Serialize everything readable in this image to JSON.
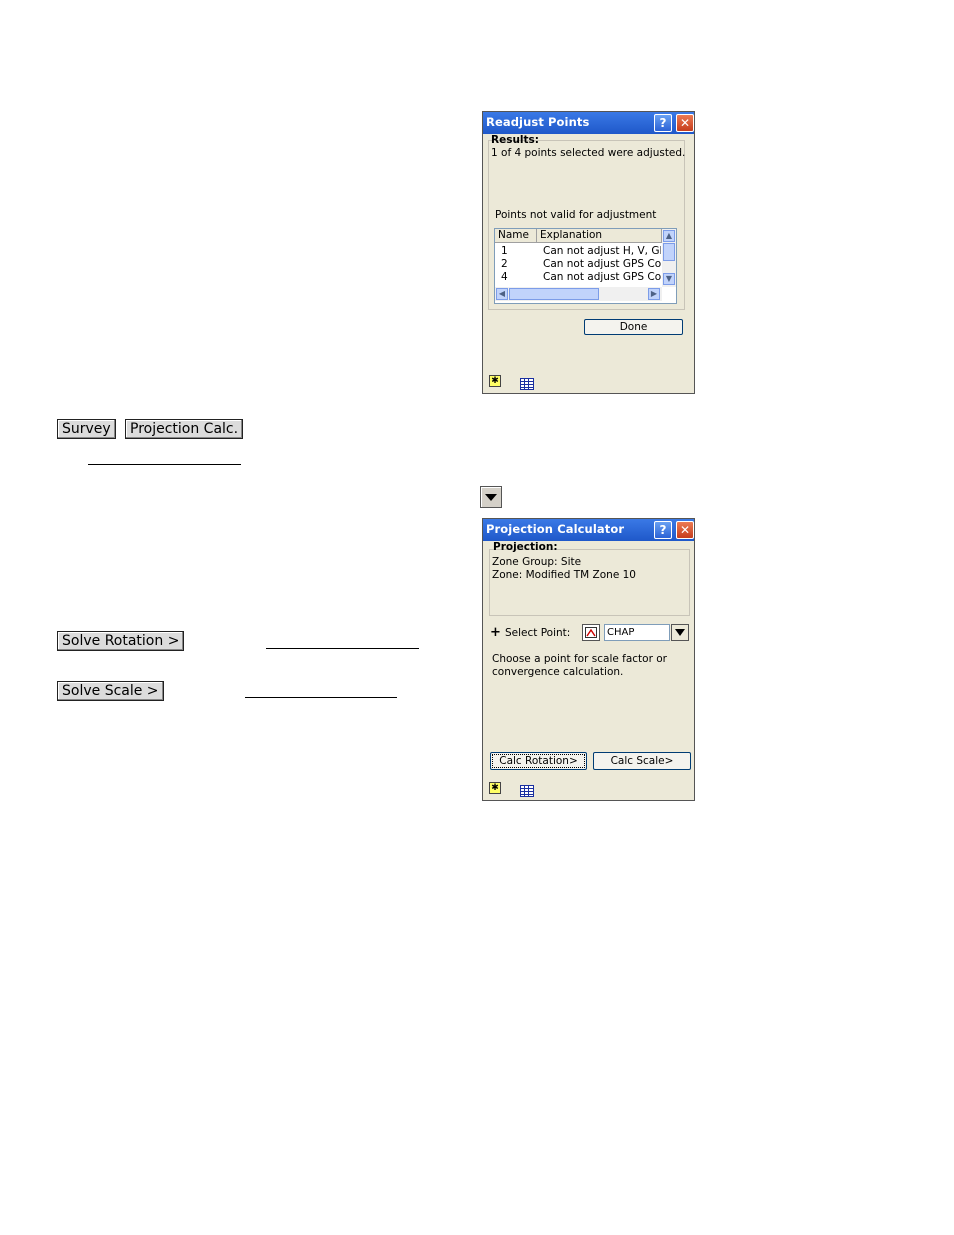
{
  "doc": {
    "survey_btn": "Survey",
    "projection_calc_btn": "Projection Calc.",
    "solve_rotation_btn": "Solve Rotation >",
    "solve_scale_btn": "Solve Scale >"
  },
  "readjust": {
    "title": "Readjust Points",
    "results_label": "Results:",
    "results_text": "1 of 4 points selected were adjusted.",
    "invalid_label": "Points not valid for adjustment",
    "columns": [
      "Name",
      "Explanation"
    ],
    "rows": [
      {
        "name": "1",
        "explanation": "Can not adjust H, V, GPS"
      },
      {
        "name": "2",
        "explanation": "Can not adjust GPS Con"
      },
      {
        "name": "4",
        "explanation": "Can not adjust GPS Con"
      }
    ],
    "done_btn": "Done"
  },
  "projcalc": {
    "title": "Projection Calculator",
    "projection_label": "Projection:",
    "zone_group": "Zone Group: Site",
    "zone": "Zone: Modified TM Zone 10",
    "select_point_label": "Select Point:",
    "select_point_value": "CHAP",
    "hint_line1": "Choose a point for scale factor or",
    "hint_line2": "convergence calculation.",
    "calc_rotation_btn": "Calc Rotation>",
    "calc_scale_btn": "Calc Scale>"
  },
  "colors": {
    "titlebar": "#1f58c9",
    "window_bg": "#ece9d8"
  },
  "icons": [
    "help-icon",
    "close-icon",
    "star-icon",
    "grid-icon",
    "dropdown-arrow-icon",
    "plus-icon",
    "point-pick-icon"
  ]
}
